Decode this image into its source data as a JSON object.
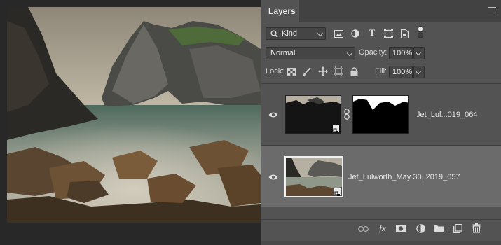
{
  "panel": {
    "tab_label": "Layers"
  },
  "filter": {
    "kind_label": "Kind"
  },
  "blend": {
    "mode": "Normal",
    "opacity_label": "Opacity:",
    "opacity_value": "100%"
  },
  "lock": {
    "label": "Lock:",
    "fill_label": "Fill:",
    "fill_value": "100%"
  },
  "layers": [
    {
      "name": "Jet_Lul...019_064",
      "visible": true,
      "selected": false,
      "has_mask": true
    },
    {
      "name": "Jet_Lulworth_May 30, 2019_057",
      "visible": true,
      "selected": true,
      "has_mask": false
    }
  ],
  "colors": {
    "panel_bg": "#535353",
    "selected_layer_bg": "#6b6b6b",
    "canvas_bg": "#282828",
    "tab_bar_bg": "#424242"
  },
  "icons": {
    "filter": [
      "search-icon",
      "image-filter-icon",
      "adjustment-filter-icon",
      "type-filter-icon",
      "shape-filter-icon",
      "smart-object-filter-icon",
      "filter-toggle-icon"
    ],
    "lock": [
      "lock-transparent-icon",
      "lock-image-icon",
      "lock-position-icon",
      "lock-artboard-icon",
      "lock-all-icon"
    ],
    "footer": [
      "link-layers-icon",
      "fx-icon",
      "add-mask-icon",
      "adjustment-layer-icon",
      "new-group-icon",
      "new-layer-icon",
      "trash-icon"
    ]
  }
}
